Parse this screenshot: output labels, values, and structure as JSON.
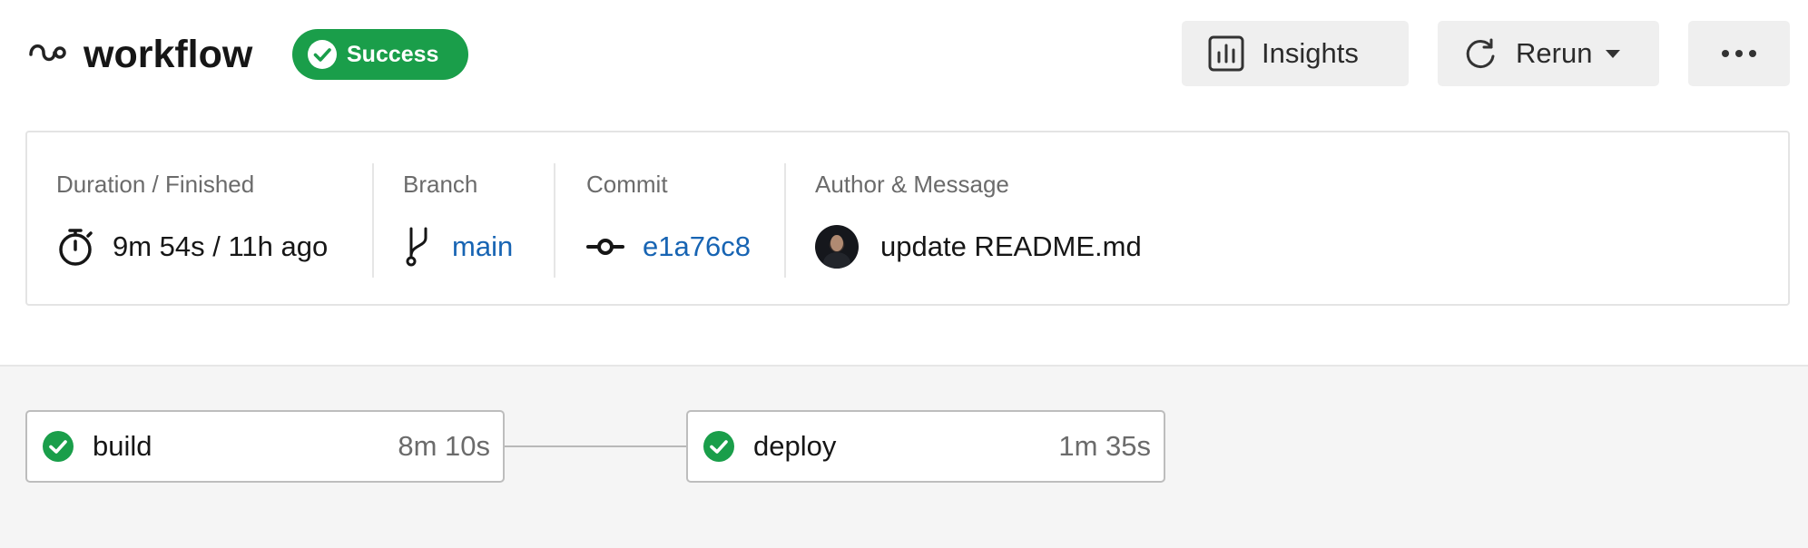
{
  "colors": {
    "accent": "#1a9e4a",
    "link": "#1764b3"
  },
  "header": {
    "workflow_icon": "workflow-icon",
    "title": "workflow",
    "status": "Success",
    "buttons": {
      "insights": "Insights",
      "rerun": "Rerun",
      "more_icon": "more-horizontal-icon"
    }
  },
  "info": {
    "duration": {
      "label": "Duration / Finished",
      "value": "9m 54s / 11h ago",
      "icon": "stopwatch-icon"
    },
    "branch": {
      "label": "Branch",
      "value": "main",
      "icon": "git-branch-icon"
    },
    "commit": {
      "label": "Commit",
      "value": "e1a76c8",
      "icon": "git-commit-icon"
    },
    "author": {
      "label": "Author & Message",
      "message": "update README.md"
    }
  },
  "jobs": [
    {
      "name": "build",
      "duration": "8m 10s",
      "status": "success"
    },
    {
      "name": "deploy",
      "duration": "1m 35s",
      "status": "success"
    }
  ]
}
